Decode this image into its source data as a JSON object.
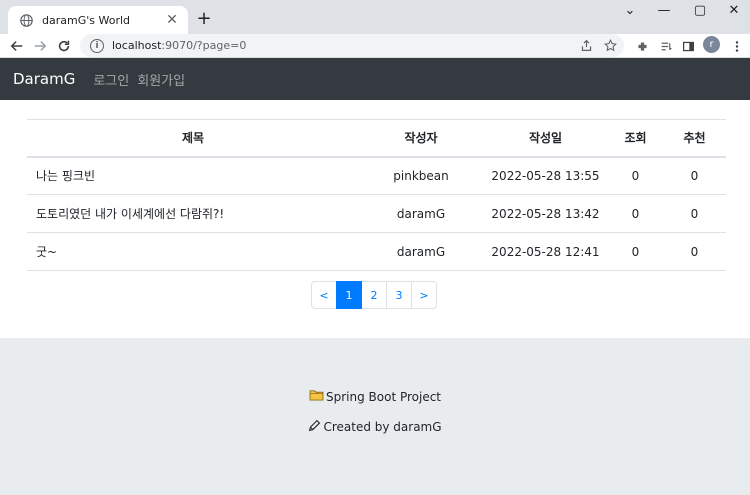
{
  "browser": {
    "tab_title": "daramG's World",
    "tab_close": "✕",
    "new_tab": "+",
    "url_host": "localhost",
    "url_rest": ":9070/?page=0",
    "avatar_letter": "r",
    "window_controls": {
      "minimize": "⌄",
      "restore": "—",
      "maximize": "▢",
      "close": "✕"
    }
  },
  "navbar": {
    "brand": "DaramG",
    "links": [
      "로그인",
      "회원가입"
    ]
  },
  "board": {
    "headers": [
      "제목",
      "작성자",
      "작성일",
      "조회",
      "추천"
    ],
    "rows": [
      {
        "title": "나는 핑크빈",
        "author": "pinkbean",
        "date": "2022-05-28 13:55",
        "views": "0",
        "likes": "0"
      },
      {
        "title": "도토리였던 내가 이세계에선 다람쥐?!",
        "author": "daramG",
        "date": "2022-05-28 13:42",
        "views": "0",
        "likes": "0"
      },
      {
        "title": "굿~",
        "author": "daramG",
        "date": "2022-05-28 12:41",
        "views": "0",
        "likes": "0"
      }
    ]
  },
  "pagination": {
    "prev": "<",
    "pages": [
      "1",
      "2",
      "3"
    ],
    "active_page": "1",
    "next": ">"
  },
  "footer": {
    "project": "Spring Boot Project",
    "credit": "Created by daramG"
  }
}
